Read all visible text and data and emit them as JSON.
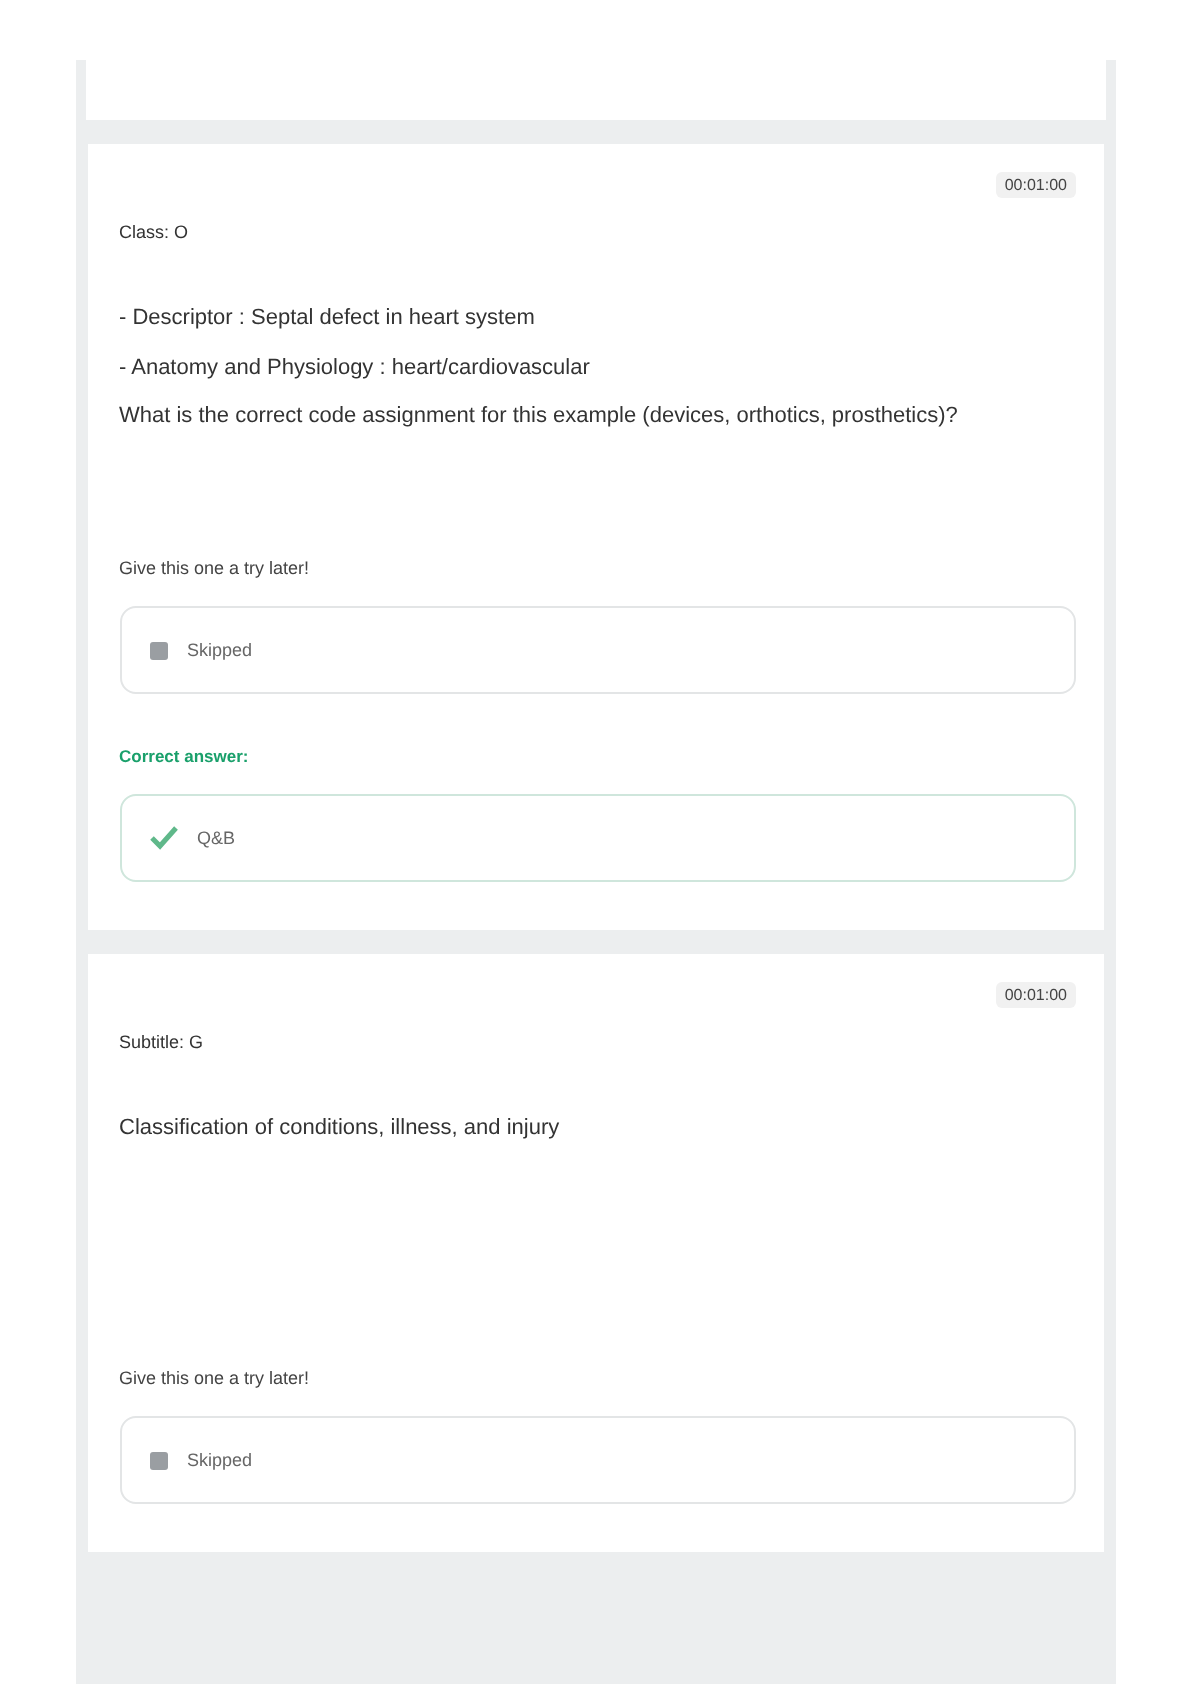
{
  "cards": [
    {
      "timer": "00:01:00",
      "heading": "Class: O",
      "prompt_lines": [
        "- Descriptor : Septal defect in heart system",
        "- Anatomy and Physiology : heart/cardiovascular",
        "What is the correct code assignment for this example (devices, orthotics, prosthetics)?"
      ],
      "question": "Give this one a try later!",
      "answer": {
        "kind": "skipped",
        "text": "Skipped"
      },
      "correct": {
        "label": "Correct answer:",
        "text": "Q&B"
      }
    },
    {
      "timer": "00:01:00",
      "heading": "Subtitle: G",
      "prompt_lines": [
        "Classification of conditions, illness, and injury"
      ],
      "question": "Give this one a try later!",
      "answer": {
        "kind": "skipped",
        "text": "Skipped"
      }
    }
  ]
}
